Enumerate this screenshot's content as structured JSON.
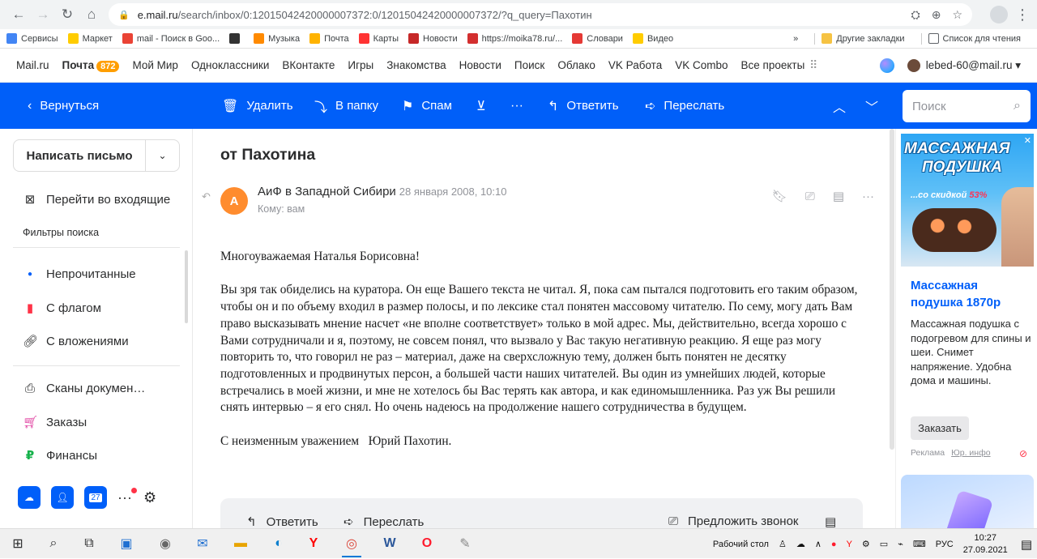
{
  "browser": {
    "url_host": "e.mail.ru",
    "url_rest": "/search/inbox/0:12015042420000007372:0/12015042420000007372/?q_query=Пахотин",
    "bookmarks": [
      {
        "label": "Сервисы",
        "color": "#4285f4"
      },
      {
        "label": "Маркет",
        "color": "#ffcc00"
      },
      {
        "label": "mail - Поиск в Goo...",
        "color": "#ea4335"
      },
      {
        "label": "",
        "color": "#333333"
      },
      {
        "label": "Музыка",
        "color": "#ff8a00"
      },
      {
        "label": "Почта",
        "color": "#ffb300"
      },
      {
        "label": "Карты",
        "color": "#ff3333"
      },
      {
        "label": "Новости",
        "color": "#c62828"
      },
      {
        "label": "https://moika78.ru/...",
        "color": "#d32f2f"
      },
      {
        "label": "Словари",
        "color": "#e53935"
      },
      {
        "label": "Видео",
        "color": "#ffcc00"
      }
    ],
    "bookmarks_overflow": "»",
    "other_bookmarks": "Другие закладки",
    "reading_list": "Список для чтения"
  },
  "portal": {
    "links": [
      "Mail.ru",
      "Почта",
      "Мой Мир",
      "Одноклассники",
      "ВКонтакте",
      "Игры",
      "Знакомства",
      "Новости",
      "Поиск",
      "Облако",
      "VK Работа",
      "VK Combo",
      "Все проекты"
    ],
    "mail_badge": "872",
    "user_email": "lebed-60@mail.ru"
  },
  "toolbar": {
    "back": "Вернуться",
    "delete": "Удалить",
    "to_folder": "В папку",
    "spam": "Спам",
    "reply": "Ответить",
    "forward": "Переслать",
    "search_placeholder": "Поиск"
  },
  "sidebar": {
    "compose": "Написать письмо",
    "go_inbox": "Перейти во входящие",
    "filters_label": "Фильтры поиска",
    "filters": [
      {
        "label": "Непрочитанные",
        "icon": "dot-icon"
      },
      {
        "label": "С флагом",
        "icon": "flag-icon"
      },
      {
        "label": "С вложениями",
        "icon": "paperclip-icon"
      }
    ],
    "folders": [
      {
        "label": "Сканы докумен…",
        "icon": "scanner-icon"
      },
      {
        "label": "Заказы",
        "icon": "cart-icon"
      },
      {
        "label": "Финансы",
        "icon": "ruble-icon"
      }
    ],
    "calendar_day": "27"
  },
  "letter": {
    "subject": "от Пахотина",
    "avatar_letter": "А",
    "sender": "АиФ в Западной Сибири",
    "date": "28 января 2008, 10:10",
    "recipient": "Кому: вам",
    "greeting": "Многоуважаемая Наталья Борисовна!",
    "paragraph": "Вы зря так обиделись на куратора. Он еще Вашего текста не читал. Я, пока сам пытался подготовить его таким образом, чтобы он и по объему входил в размер полосы, и по лексике стал понятен массовому читателю. По сему, могу дать Вам право высказывать мнение насчет «не вполне соответствует» только в мой адрес. Мы, действительно, всегда хорошо с Вами сотрудничали и я, поэтому, не совсем понял, что вызвало у Вас такую негативную реакцию. Я еще раз могу повторить то, что говорил не раз – материал, даже на сверхсложную тему, должен быть понятен не десятку подготовленных и продвинутых персон, а большей части наших читателей. Вы один из умнейших людей, которые встречались в моей жизни, и мне не хотелось бы Вас терять как автора, и как единомышленника. Раз уж Вы решили снять интервью – я его снял. Но очень надеюсь на продолжение нашего сотрудничества в будущем.",
    "signature": "С неизменным уважением   Юрий Пахотин.",
    "reply_bar": {
      "reply": "Ответить",
      "forward": "Переслать",
      "suggest_call": "Предложить звонок"
    }
  },
  "ad": {
    "image_line1": "МАССАЖНАЯ",
    "image_line2": "ПОДУШКА",
    "image_line3": "...со скидкой",
    "image_discount": "53%",
    "title": "Массажная подушка 1870р",
    "text": "Массажная подушка с подогревом для спины и шеи. Снимет напряжение. Удобна дома и машины.",
    "button": "Заказать",
    "label": "Реклама",
    "legal": "Юр. инфо"
  },
  "taskbar": {
    "desktop_label": "Рабочий стол",
    "language": "РУС",
    "time": "10:27",
    "date": "27.09.2021"
  },
  "colors": {
    "accent": "#005ff9",
    "badge": "#ff9e00",
    "avatar": "#ff8c2e"
  }
}
